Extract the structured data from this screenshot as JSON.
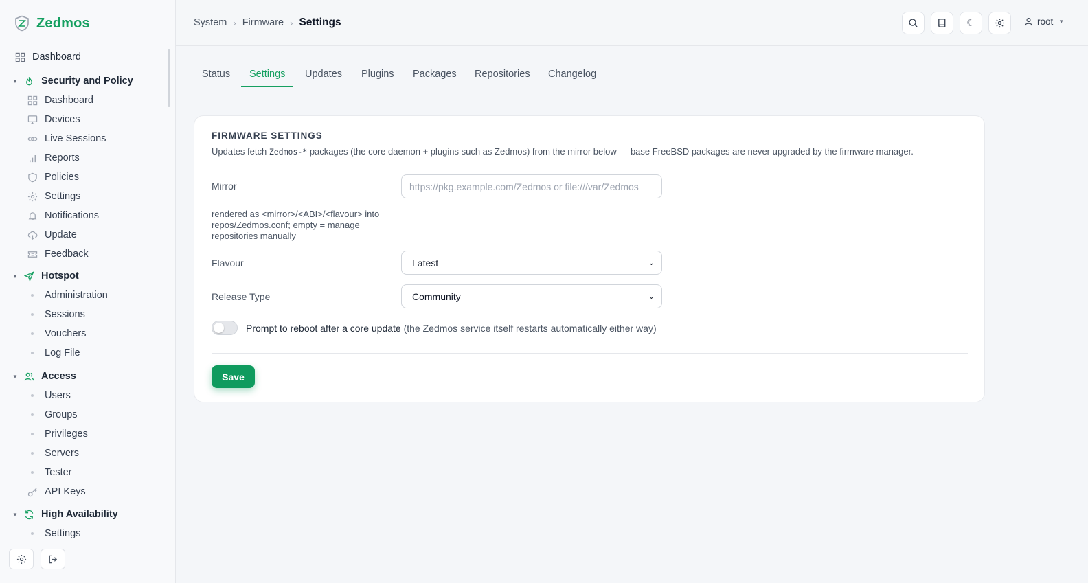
{
  "brand": {
    "name": "Zedmos"
  },
  "sidebar": {
    "top_item": "Dashboard",
    "groups": [
      {
        "title": "Security and Policy",
        "items": [
          "Dashboard",
          "Devices",
          "Live Sessions",
          "Reports",
          "Policies",
          "Settings",
          "Notifications",
          "Update",
          "Feedback"
        ]
      },
      {
        "title": "Hotspot",
        "items": [
          "Administration",
          "Sessions",
          "Vouchers",
          "Log File"
        ]
      },
      {
        "title": "Access",
        "items": [
          "Users",
          "Groups",
          "Privileges",
          "Servers",
          "Tester",
          "API Keys"
        ]
      },
      {
        "title": "High Availability",
        "items": [
          "Settings"
        ]
      }
    ],
    "icons": {
      "top": "dashboard-icon",
      "security": "flame-icon",
      "hotspot": "send-icon",
      "access": "users-icon",
      "ha": "refresh-icon"
    }
  },
  "header": {
    "breadcrumb": [
      "System",
      "Firmware",
      "Settings"
    ],
    "user": "root",
    "buttons": [
      "search-icon",
      "book-icon",
      "moon-icon",
      "gear-icon"
    ]
  },
  "tabs": [
    "Status",
    "Settings",
    "Updates",
    "Plugins",
    "Packages",
    "Repositories",
    "Changelog"
  ],
  "active_tab": "Settings",
  "card": {
    "title": "FIRMWARE SETTINGS",
    "desc_prefix": "Updates fetch ",
    "desc_code": "Zedmos-*",
    "desc_suffix": " packages (the core daemon + plugins such as Zedmos) from the mirror below — base FreeBSD packages are never upgraded by the firmware manager.",
    "mirror_label": "Mirror",
    "mirror_placeholder": "https://pkg.example.com/Zedmos  or  file:///var/Zedmos",
    "mirror_help": "rendered as <mirror>/<ABI>/<flavour> into repos/Zedmos.conf; empty = manage repositories manually",
    "flavour_label": "Flavour",
    "flavour_value": "Latest",
    "release_label": "Release Type",
    "release_value": "Community",
    "reboot_label": "Prompt to reboot after a core update",
    "reboot_note": "(the Zedmos service itself restarts automatically either way)",
    "reboot_enabled": false,
    "save_label": "Save"
  },
  "colors": {
    "accent": "#16a061",
    "save": "#0f9b5e"
  }
}
